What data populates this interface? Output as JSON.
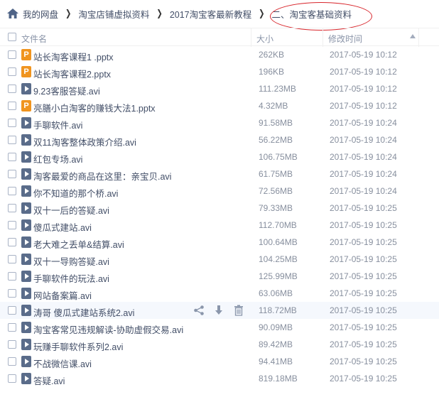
{
  "breadcrumb": {
    "items": [
      "我的网盘",
      "淘宝店铺虚拟资料",
      "2017淘宝客最新教程",
      "二、淘宝客基础资料"
    ]
  },
  "header": {
    "name_label": "文件名",
    "size_label": "大小",
    "date_label": "修改时间"
  },
  "icons": {
    "home": "home-icon",
    "ppt": "ppt-file-icon",
    "avi": "video-file-icon",
    "share": "share-icon",
    "download": "download-icon",
    "delete": "trash-icon",
    "ppt_glyph": "P"
  },
  "colors": {
    "ppt": "#f0941f",
    "video": "#5a6c8a",
    "annotation": "#d8252b"
  },
  "files": [
    {
      "name": "站长淘客课程1 .pptx",
      "size": "262KB",
      "date": "2017-05-19 10:12",
      "type": "ppt"
    },
    {
      "name": "站长淘客课程2.pptx",
      "size": "196KB",
      "date": "2017-05-19 10:12",
      "type": "ppt"
    },
    {
      "name": "9.23客服答疑.avi",
      "size": "111.23MB",
      "date": "2017-05-19 10:12",
      "type": "avi"
    },
    {
      "name": "亮膳小白淘客的赚钱大法1.pptx",
      "size": "4.32MB",
      "date": "2017-05-19 10:12",
      "type": "ppt"
    },
    {
      "name": "手聊软件.avi",
      "size": "91.58MB",
      "date": "2017-05-19 10:24",
      "type": "avi"
    },
    {
      "name": "双11淘客整体政策介绍.avi",
      "size": "56.22MB",
      "date": "2017-05-19 10:24",
      "type": "avi"
    },
    {
      "name": "红包专场.avi",
      "size": "106.75MB",
      "date": "2017-05-19 10:24",
      "type": "avi"
    },
    {
      "name": "淘客最爱的商品在这里：亲宝贝.avi",
      "size": "61.75MB",
      "date": "2017-05-19 10:24",
      "type": "avi"
    },
    {
      "name": "你不知道的那个桥.avi",
      "size": "72.56MB",
      "date": "2017-05-19 10:24",
      "type": "avi"
    },
    {
      "name": "双十一后的答疑.avi",
      "size": "79.33MB",
      "date": "2017-05-19 10:25",
      "type": "avi"
    },
    {
      "name": "傻瓜式建站.avi",
      "size": "112.70MB",
      "date": "2017-05-19 10:25",
      "type": "avi"
    },
    {
      "name": "老大难之丢单&结算.avi",
      "size": "100.64MB",
      "date": "2017-05-19 10:25",
      "type": "avi"
    },
    {
      "name": "双十一导购答疑.avi",
      "size": "104.25MB",
      "date": "2017-05-19 10:25",
      "type": "avi"
    },
    {
      "name": "手聊软件的玩法.avi",
      "size": "125.99MB",
      "date": "2017-05-19 10:25",
      "type": "avi"
    },
    {
      "name": "网站备案篇.avi",
      "size": "63.06MB",
      "date": "2017-05-19 10:25",
      "type": "avi"
    },
    {
      "name": "涛哥 傻瓜式建站系统2.avi",
      "size": "118.72MB",
      "date": "2017-05-19 10:25",
      "type": "avi",
      "hover": true
    },
    {
      "name": "淘宝客常见违规解读-协助虚假交易.avi",
      "size": "90.09MB",
      "date": "2017-05-19 10:25",
      "type": "avi"
    },
    {
      "name": "玩赚手聊软件系列2.avi",
      "size": "89.42MB",
      "date": "2017-05-19 10:25",
      "type": "avi"
    },
    {
      "name": "不战微信课.avi",
      "size": "94.41MB",
      "date": "2017-05-19 10:25",
      "type": "avi"
    },
    {
      "name": "答疑.avi",
      "size": "819.18MB",
      "date": "2017-05-19 10:25",
      "type": "avi"
    }
  ]
}
